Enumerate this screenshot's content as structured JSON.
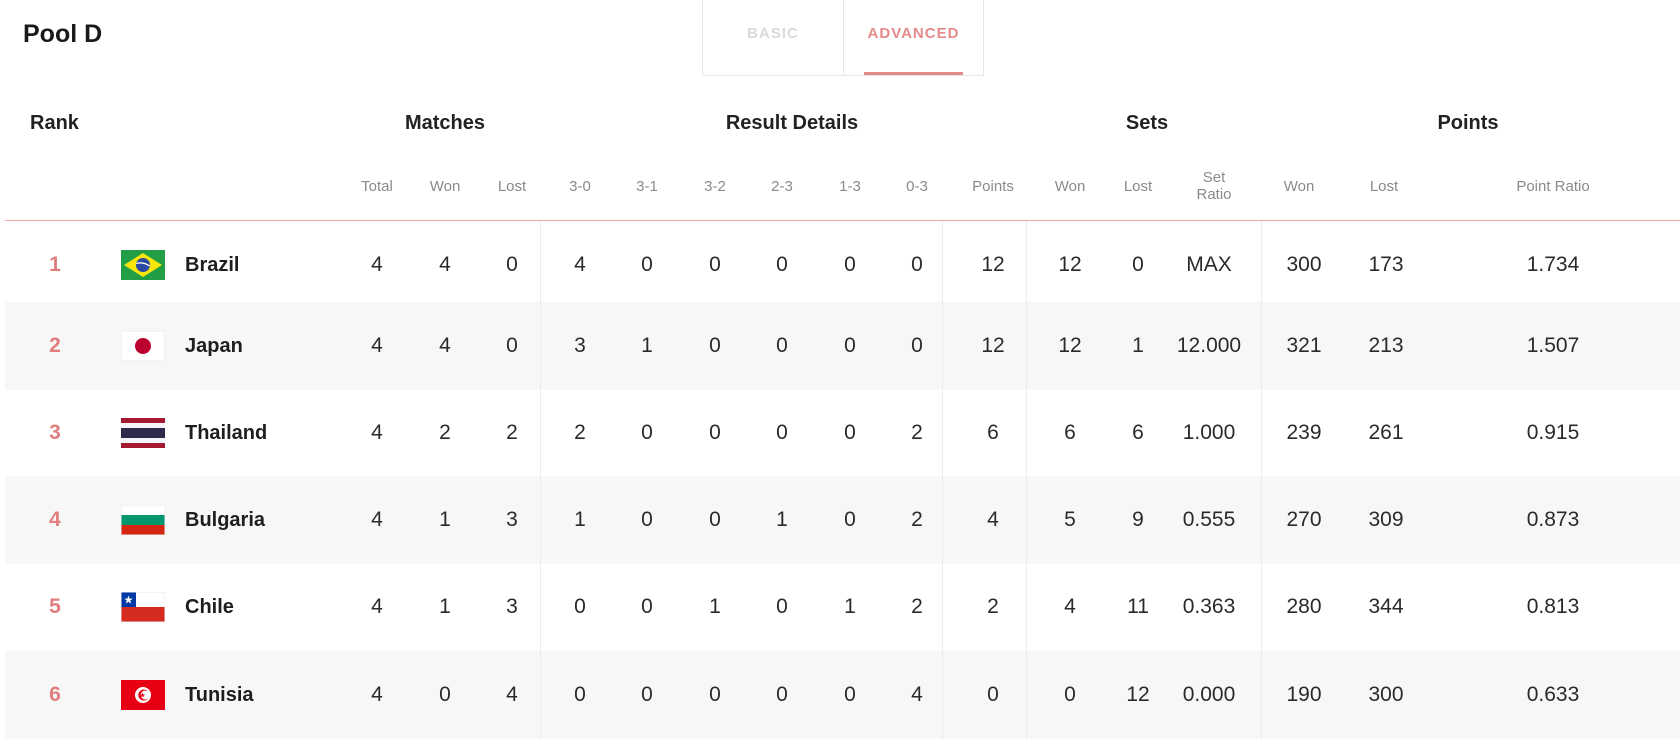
{
  "pool_title": "Pool D",
  "tabs": {
    "basic": "BASIC",
    "advanced": "ADVANCED",
    "active": "advanced"
  },
  "groups": {
    "rank": "Rank",
    "matches": "Matches",
    "result_details": "Result Details",
    "sets": "Sets",
    "points": "Points"
  },
  "subheaders": {
    "m_total": "Total",
    "m_won": "Won",
    "m_lost": "Lost",
    "r_30": "3-0",
    "r_31": "3-1",
    "r_32": "3-2",
    "r_23": "2-3",
    "r_13": "1-3",
    "r_03": "0-3",
    "r_points": "Points",
    "s_won": "Won",
    "s_lost": "Lost",
    "s_ratio_1": "Set",
    "s_ratio_2": "Ratio",
    "p_won": "Won",
    "p_lost": "Lost",
    "p_ratio": "Point Ratio"
  },
  "colors": {
    "accent": "#e58a8a",
    "rank": "#e07e7e",
    "row_shade": "#f7f7f7"
  },
  "rows": [
    {
      "rank": "1",
      "team": "Brazil",
      "flag": "brazil-flag",
      "total": "4",
      "won": "4",
      "lost": "0",
      "r30": "4",
      "r31": "0",
      "r32": "0",
      "r23": "0",
      "r13": "0",
      "r03": "0",
      "points": "12",
      "sets_won": "12",
      "sets_lost": "0",
      "set_ratio": "MAX",
      "pts_won": "300",
      "pts_lost": "173",
      "point_ratio": "1.734"
    },
    {
      "rank": "2",
      "team": "Japan",
      "flag": "japan-flag",
      "total": "4",
      "won": "4",
      "lost": "0",
      "r30": "3",
      "r31": "1",
      "r32": "0",
      "r23": "0",
      "r13": "0",
      "r03": "0",
      "points": "12",
      "sets_won": "12",
      "sets_lost": "1",
      "set_ratio": "12.000",
      "pts_won": "321",
      "pts_lost": "213",
      "point_ratio": "1.507"
    },
    {
      "rank": "3",
      "team": "Thailand",
      "flag": "thailand-flag",
      "total": "4",
      "won": "2",
      "lost": "2",
      "r30": "2",
      "r31": "0",
      "r32": "0",
      "r23": "0",
      "r13": "0",
      "r03": "2",
      "points": "6",
      "sets_won": "6",
      "sets_lost": "6",
      "set_ratio": "1.000",
      "pts_won": "239",
      "pts_lost": "261",
      "point_ratio": "0.915"
    },
    {
      "rank": "4",
      "team": "Bulgaria",
      "flag": "bulgaria-flag",
      "total": "4",
      "won": "1",
      "lost": "3",
      "r30": "1",
      "r31": "0",
      "r32": "0",
      "r23": "1",
      "r13": "0",
      "r03": "2",
      "points": "4",
      "sets_won": "5",
      "sets_lost": "9",
      "set_ratio": "0.555",
      "pts_won": "270",
      "pts_lost": "309",
      "point_ratio": "0.873"
    },
    {
      "rank": "5",
      "team": "Chile",
      "flag": "chile-flag",
      "total": "4",
      "won": "1",
      "lost": "3",
      "r30": "0",
      "r31": "0",
      "r32": "1",
      "r23": "0",
      "r13": "1",
      "r03": "2",
      "points": "2",
      "sets_won": "4",
      "sets_lost": "11",
      "set_ratio": "0.363",
      "pts_won": "280",
      "pts_lost": "344",
      "point_ratio": "0.813"
    },
    {
      "rank": "6",
      "team": "Tunisia",
      "flag": "tunisia-flag",
      "total": "4",
      "won": "0",
      "lost": "4",
      "r30": "0",
      "r31": "0",
      "r32": "0",
      "r23": "0",
      "r13": "0",
      "r03": "4",
      "points": "0",
      "sets_won": "0",
      "sets_lost": "12",
      "set_ratio": "0.000",
      "pts_won": "190",
      "pts_lost": "300",
      "point_ratio": "0.633"
    }
  ]
}
